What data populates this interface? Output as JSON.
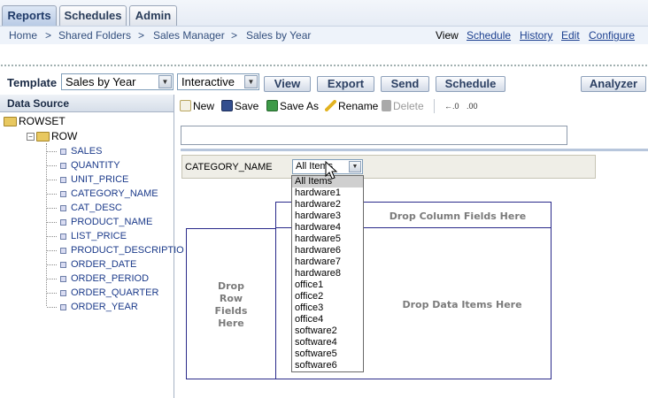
{
  "tabs": [
    {
      "label": "Reports",
      "active": true
    },
    {
      "label": "Schedules",
      "active": false
    },
    {
      "label": "Admin",
      "active": false
    }
  ],
  "breadcrumb": {
    "items": [
      "Home",
      "Shared Folders",
      "Sales Manager",
      "Sales by Year"
    ],
    "separator": ">",
    "actions_label": "View",
    "actions": [
      "Schedule",
      "History",
      "Edit",
      "Configure"
    ]
  },
  "template_bar": {
    "label": "Template",
    "template_value": "Sales by Year",
    "mode_value": "Interactive",
    "buttons": [
      "View",
      "Export",
      "Send",
      "Schedule"
    ],
    "analyzer_button": "Analyzer"
  },
  "data_source": {
    "header": "Data Source",
    "root": "ROWSET",
    "group": "ROW",
    "fields": [
      "SALES",
      "QUANTITY",
      "UNIT_PRICE",
      "CATEGORY_NAME",
      "CAT_DESC",
      "PRODUCT_NAME",
      "LIST_PRICE",
      "PRODUCT_DESCRIPTIO",
      "ORDER_DATE",
      "ORDER_PERIOD",
      "ORDER_QUARTER",
      "ORDER_YEAR"
    ]
  },
  "toolbar": {
    "new": "New",
    "save": "Save",
    "save_as": "Save As",
    "rename": "Rename",
    "delete": "Delete",
    "decrease_decimal": "←.0",
    "increase_decimal": ".00"
  },
  "filter": {
    "field_label": "CATEGORY_NAME",
    "selected": "All Items",
    "options": [
      "All Items",
      "hardware1",
      "hardware2",
      "hardware3",
      "hardware4",
      "hardware5",
      "hardware6",
      "hardware7",
      "hardware8",
      "office1",
      "office2",
      "office3",
      "office4",
      "software2",
      "software4",
      "software5",
      "software6"
    ]
  },
  "drop_zones": {
    "columns": "Drop Column Fields Here",
    "rows_line1": "Drop",
    "rows_line2": "Row",
    "rows_line3": "Fields",
    "rows_line4": "Here",
    "data": "Drop Data Items Here"
  },
  "colors": {
    "tab_active": "#b9cbe5",
    "link": "#1b3f8f",
    "tree_text": "#1b3a8a",
    "region_border": "#2a2a8a"
  }
}
